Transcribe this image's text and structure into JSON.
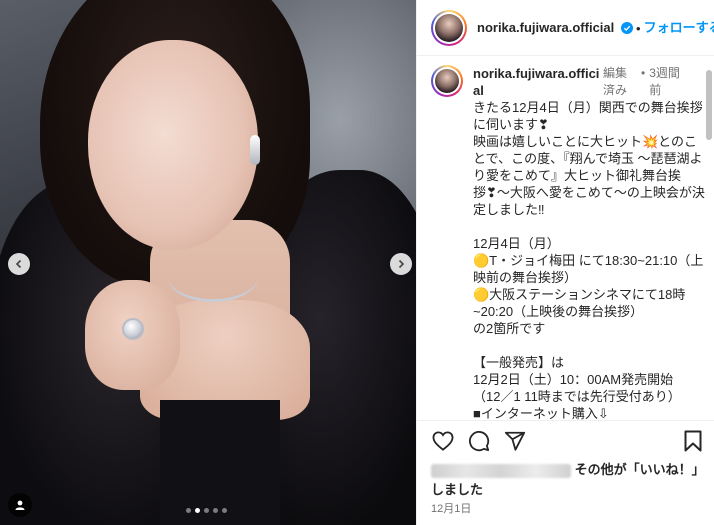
{
  "post": {
    "username": "norika.fujiwara.official",
    "follow_label": "フォローする",
    "separator": "•"
  },
  "caption": {
    "username": "norika.fujiwara.official",
    "edited": "編集済み",
    "dot": "•",
    "time": "3週間前",
    "text": "きたる12月4日（月）関西での舞台挨拶に伺います❣\n映画は嬉しいことに大ヒット💥とのことで、この度、『翔んで埼玉 〜琵琶湖より愛をこめて』大ヒット御礼舞台挨拶❣〜大阪へ愛をこめて〜の上映会が決定しました‼\n\n12月4日（月）\n🟡T・ジョイ梅田 にて18:30~21:10（上映前の舞台挨拶）\n🟡大阪ステーションシネマにて18時~20:20（上映後の舞台挨拶）\nの2箇所です\n\n【一般発売】は\n12月2日（土）10：00AM発売開始\n（12／1 11時までは先行受付あり）\n■インターネット購入⇩\nhttps://w.pia.jp/t/tondesaitama/"
  },
  "likes": {
    "suffix": "その他が「いいね！」しました"
  },
  "date": "12月1日",
  "icons": {
    "verified": "verified-badge-icon",
    "more": "more-options-icon",
    "like": "heart-icon",
    "comment": "comment-icon",
    "share": "share-icon",
    "save": "bookmark-icon",
    "prev": "chevron-left-icon",
    "next": "chevron-right-icon",
    "tag": "user-tag-icon"
  },
  "carousel": {
    "total": 5,
    "active_index": 1
  },
  "colors": {
    "follow": "#0095f6",
    "text": "#262626",
    "meta": "#737373"
  }
}
